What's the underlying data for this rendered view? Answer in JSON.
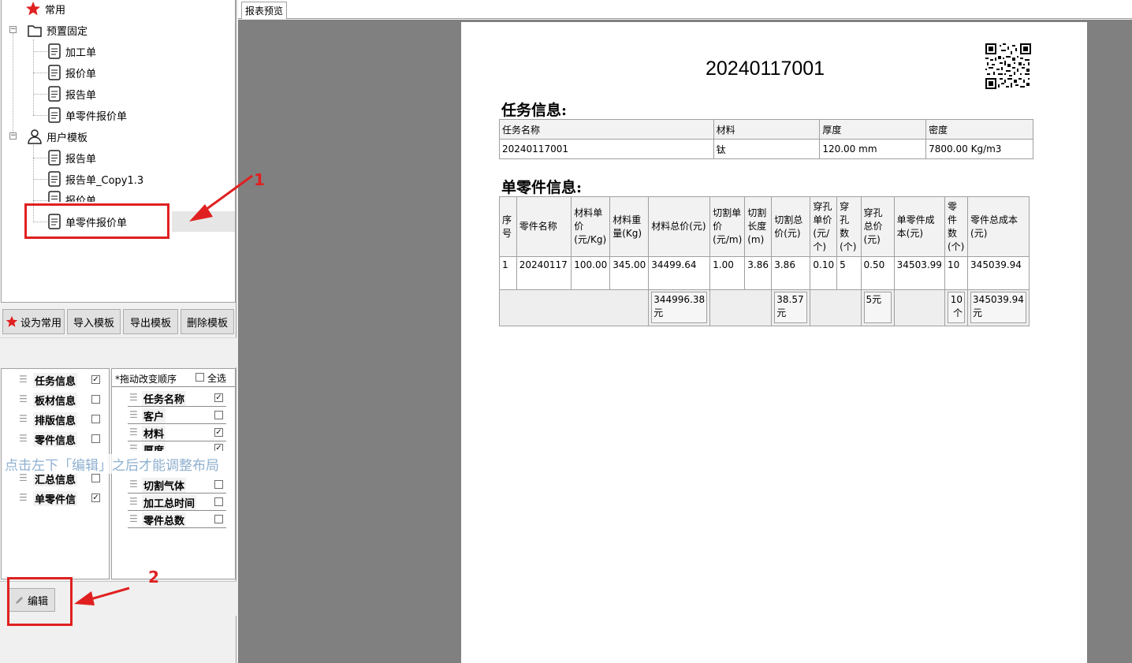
{
  "tree": {
    "common": "常用",
    "preset": "预置固定",
    "preset_items": [
      "加工单",
      "报价单",
      "报告单",
      "单零件报价单"
    ],
    "user": "用户模板",
    "user_items": [
      "报告单",
      "报告单_Copy1.3",
      "报价单",
      "单零件报价单"
    ]
  },
  "toolbar": {
    "set_common": "设为常用",
    "import": "导入模板",
    "export": "导出模板",
    "delete": "删除模板"
  },
  "sections": [
    {
      "label": "任务信息",
      "checked": true
    },
    {
      "label": "板材信息",
      "checked": false
    },
    {
      "label": "排版信息",
      "checked": false
    },
    {
      "label": "零件信息",
      "checked": false
    },
    {
      "label": "汇总信息",
      "checked": false
    },
    {
      "label": "单零件信",
      "checked": true
    }
  ],
  "fields_header": {
    "hint": "*拖动改变顺序",
    "select_all": "全选"
  },
  "fields": [
    {
      "label": "任务名称",
      "checked": true
    },
    {
      "label": "客户",
      "checked": false
    },
    {
      "label": "材料",
      "checked": true
    },
    {
      "label": "厚度",
      "checked": true
    },
    {
      "label": "切割气体",
      "checked": false
    },
    {
      "label": "加工总时间",
      "checked": false
    },
    {
      "label": "零件总数",
      "checked": false
    }
  ],
  "overlay_hint": "点击左下「编辑」之后才能调整布局",
  "edit_button": "编辑",
  "tab_label": "报表预览",
  "report": {
    "title": "20240117001",
    "task_section": "任务信息:",
    "task_headers": [
      "任务名称",
      "材料",
      "厚度",
      "密度"
    ],
    "task_values": [
      "20240117001",
      "钛",
      "120.00 mm",
      "7800.00 Kg/m3"
    ],
    "part_section": "单零件信息:",
    "part_headers": [
      "序号",
      "零件名称",
      "材料单价(元/Kg)",
      "材料重量(Kg)",
      "材料总价(元)",
      "切割单价(元/m)",
      "切割长度(m)",
      "切割总价(元)",
      "穿孔单价(元/个)",
      "穿孔数(个)",
      "穿孔总价(元)",
      "单零件成本(元)",
      "零件数(个)",
      "零件总成本(元)"
    ],
    "part_row": [
      "1",
      "20240117",
      "100.00",
      "345.00",
      "34499.64",
      "1.00",
      "3.86",
      "3.86",
      "0.10",
      "5",
      "0.50",
      "34503.99",
      "10",
      "345039.94"
    ],
    "sum_row": {
      "material_total": "344996.38元",
      "cut_total": "38.57元",
      "pierce_total": "5元",
      "count_total": "10个",
      "cost_total": "345039.94元"
    }
  },
  "annotations": {
    "one": "1",
    "two": "2"
  },
  "colors": {
    "annotation": "#e02020",
    "preview_bg": "#808080",
    "star": "#e02020"
  }
}
